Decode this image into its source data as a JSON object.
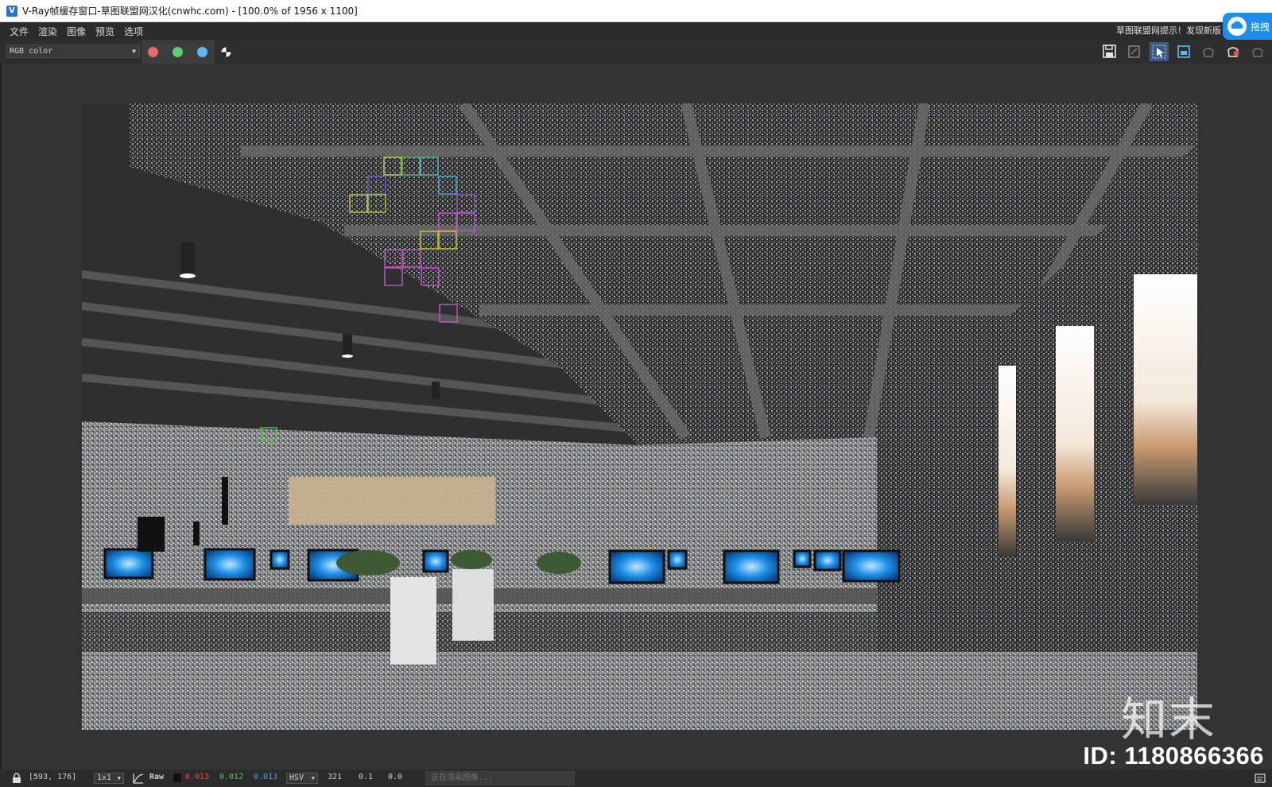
{
  "window": {
    "title": "V-Ray帧缓存窗口-草图联盟网汉化(cnwhc.com) - [100.0% of 1956 x 1100]",
    "cloud_label": "拖拽"
  },
  "menu": {
    "items": [
      "文件",
      "渲染",
      "图像",
      "预览",
      "选项"
    ],
    "hint": "草图联盟网提示！发现新版"
  },
  "toolbar": {
    "channel": "RGB color",
    "channel_colors": {
      "red": "#e86b6b",
      "green": "#5ccf73",
      "blue": "#5cb8ef"
    },
    "right_tools": [
      "save-image-icon",
      "clear-image-icon",
      "track-mouse-icon",
      "region-render-icon",
      "render-last-icon",
      "render-icon",
      "stop-render-icon"
    ]
  },
  "viewport": {
    "id_text": "ID: 1180866366",
    "logo_text": "知末"
  },
  "status": {
    "coords": "[593, 176]",
    "zoom": "1x1",
    "mode": "Raw",
    "r": "0.013",
    "g": "0.012",
    "b": "0.013",
    "colorspace": "HSV",
    "h": "321",
    "s": "0.1",
    "v": "0.0",
    "progress_text": "正在渲染图像..."
  },
  "colors": {
    "accent": "#1e8df0",
    "bg": "#333333",
    "r": "#e05050",
    "g": "#50c060",
    "b": "#4aa0e8"
  }
}
